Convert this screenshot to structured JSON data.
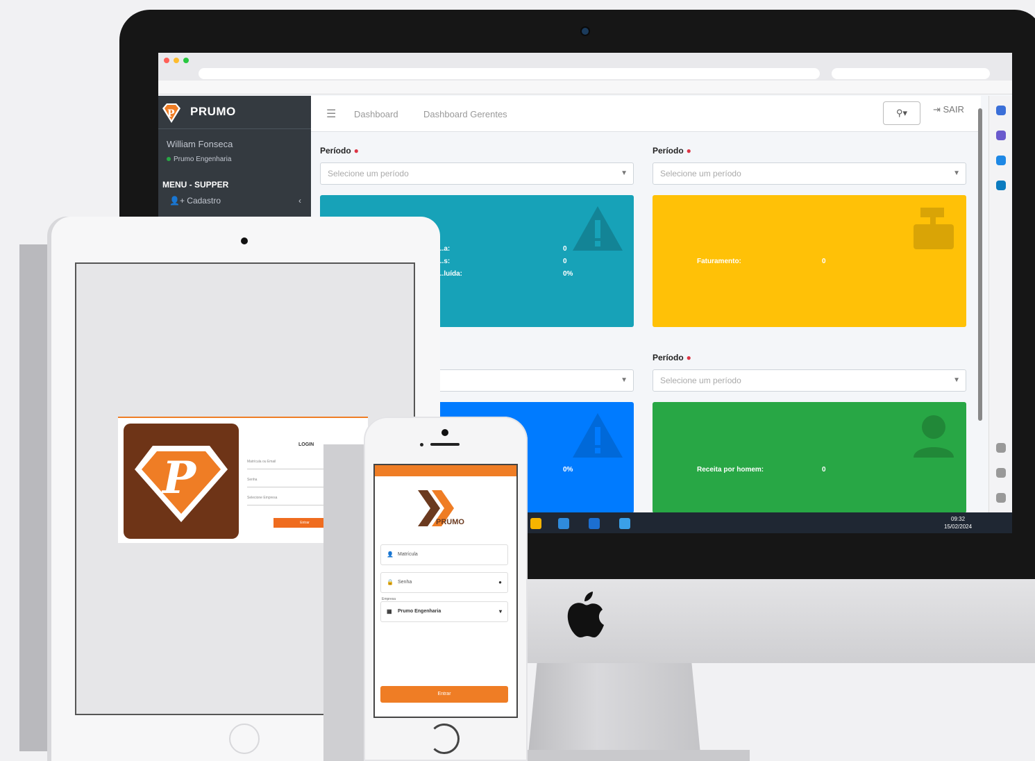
{
  "colors": {
    "sidebar": "#343a40",
    "teal_card": "#17a2b8",
    "yellow_card": "#ffc107",
    "blue_card": "#007bff",
    "green_card": "#28a745",
    "brand_orange": "#ef7d25",
    "brand_brown": "#6e3417"
  },
  "sidebar": {
    "brand": "PRUMO",
    "user_name": "William Fonseca",
    "user_org": "Prumo Engenharia",
    "menu_header": "MENU - SUPPER",
    "menu_items": [
      {
        "label": "Cadastro",
        "icon": "user-plus-icon"
      }
    ]
  },
  "topnav": {
    "tabs": [
      "Dashboard",
      "Dashboard Gerentes"
    ],
    "user_button": "⚲▾",
    "logout": "SAIR"
  },
  "filters": {
    "label": "Período",
    "placeholder": "Selecione um período"
  },
  "cards": {
    "teal": {
      "rows": [
        {
          "label": "...a:",
          "value": "0"
        },
        {
          "label": "...s:",
          "value": "0"
        },
        {
          "label": "...luída:",
          "value": "0%"
        }
      ]
    },
    "yellow": {
      "rows": [
        {
          "label": "Faturamento:",
          "value": "0"
        }
      ]
    },
    "blue": {
      "rows": [
        {
          "label": "",
          "value": "0%"
        }
      ]
    },
    "green": {
      "rows": [
        {
          "label": "Receita por homem:",
          "value": "0"
        }
      ]
    }
  },
  "taskbar": {
    "time": "09:32",
    "date": "15/02/2024"
  },
  "tablet_login": {
    "title": "LOGIN",
    "fields": [
      "Matrícula ou Email",
      "Senha",
      "Selecione Empresa"
    ],
    "button": "Entrar"
  },
  "phone_login": {
    "brand": "PRUMO",
    "fields": [
      {
        "placeholder": "Matrícula",
        "icon": "user-icon"
      },
      {
        "placeholder": "Senha",
        "icon": "lock-icon"
      }
    ],
    "company_label": "Empresa",
    "company_value": "Prumo Engenharia",
    "button": "Entrar"
  }
}
